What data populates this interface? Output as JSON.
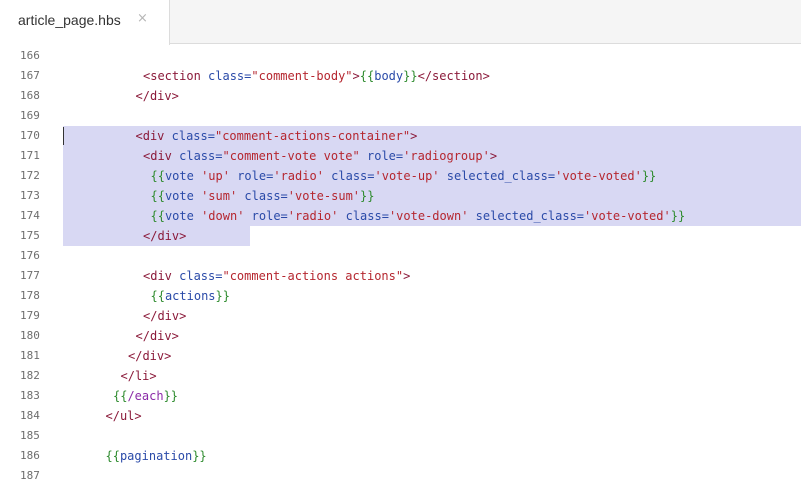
{
  "tab": {
    "title": "article_page.hbs",
    "close_glyph": "×"
  },
  "selection_color": "#d8d8f3",
  "lines": [
    {
      "n": "166",
      "indent": 0,
      "tokens": []
    },
    {
      "n": "167",
      "indent": 9,
      "tokens": [
        [
          "tag",
          "<section "
        ],
        [
          "attr",
          "class="
        ],
        [
          "strv",
          "\"comment-body\""
        ],
        [
          "tag",
          ">"
        ],
        [
          "hb",
          "{{"
        ],
        [
          "hbn",
          "body"
        ],
        [
          "hb",
          "}}"
        ],
        [
          "tag",
          "</section>"
        ]
      ]
    },
    {
      "n": "168",
      "indent": 8,
      "tokens": [
        [
          "tag",
          "</div>"
        ]
      ]
    },
    {
      "n": "169",
      "indent": 0,
      "tokens": []
    },
    {
      "n": "170",
      "indent": 8,
      "tokens": [
        [
          "tag",
          "<div "
        ],
        [
          "attr",
          "class="
        ],
        [
          "strv",
          "\"comment-actions-container\""
        ],
        [
          "tag",
          ">"
        ]
      ]
    },
    {
      "n": "171",
      "indent": 9,
      "tokens": [
        [
          "tag",
          "<div "
        ],
        [
          "attr",
          "class="
        ],
        [
          "strv",
          "\"comment-vote vote\""
        ],
        [
          "attr",
          " role="
        ],
        [
          "strv",
          "'radiogroup'"
        ],
        [
          "tag",
          ">"
        ]
      ]
    },
    {
      "n": "172",
      "indent": 10,
      "tokens": [
        [
          "hb",
          "{{"
        ],
        [
          "hbn",
          "vote "
        ],
        [
          "strv",
          "'up'"
        ],
        [
          "hbn",
          " role="
        ],
        [
          "strv",
          "'radio'"
        ],
        [
          "hbn",
          " class="
        ],
        [
          "strv",
          "'vote-up'"
        ],
        [
          "hbn",
          " selected_class="
        ],
        [
          "strv",
          "'vote-voted'"
        ],
        [
          "hb",
          "}}"
        ]
      ]
    },
    {
      "n": "173",
      "indent": 10,
      "tokens": [
        [
          "hb",
          "{{"
        ],
        [
          "hbn",
          "vote "
        ],
        [
          "strv",
          "'sum'"
        ],
        [
          "hbn",
          " class="
        ],
        [
          "strv",
          "'vote-sum'"
        ],
        [
          "hb",
          "}}"
        ]
      ]
    },
    {
      "n": "174",
      "indent": 10,
      "tokens": [
        [
          "hb",
          "{{"
        ],
        [
          "hbn",
          "vote "
        ],
        [
          "strv",
          "'down'"
        ],
        [
          "hbn",
          " role="
        ],
        [
          "strv",
          "'radio'"
        ],
        [
          "hbn",
          " class="
        ],
        [
          "strv",
          "'vote-down'"
        ],
        [
          "hbn",
          " selected_class="
        ],
        [
          "strv",
          "'vote-voted'"
        ],
        [
          "hb",
          "}}"
        ]
      ]
    },
    {
      "n": "175",
      "indent": 9,
      "tokens": [
        [
          "tag",
          "</div>"
        ]
      ]
    },
    {
      "n": "176",
      "indent": 0,
      "tokens": []
    },
    {
      "n": "177",
      "indent": 9,
      "tokens": [
        [
          "tag",
          "<div "
        ],
        [
          "attr",
          "class="
        ],
        [
          "strv",
          "\"comment-actions actions\""
        ],
        [
          "tag",
          ">"
        ]
      ]
    },
    {
      "n": "178",
      "indent": 10,
      "tokens": [
        [
          "hb",
          "{{"
        ],
        [
          "hbn",
          "actions"
        ],
        [
          "hb",
          "}}"
        ]
      ]
    },
    {
      "n": "179",
      "indent": 9,
      "tokens": [
        [
          "tag",
          "</div>"
        ]
      ]
    },
    {
      "n": "180",
      "indent": 8,
      "tokens": [
        [
          "tag",
          "</div>"
        ]
      ]
    },
    {
      "n": "181",
      "indent": 7,
      "tokens": [
        [
          "tag",
          "</div>"
        ]
      ]
    },
    {
      "n": "182",
      "indent": 6,
      "tokens": [
        [
          "tag",
          "</li>"
        ]
      ]
    },
    {
      "n": "183",
      "indent": 5,
      "tokens": [
        [
          "hb",
          "{{"
        ],
        [
          "hbkw",
          "/each"
        ],
        [
          "hb",
          "}}"
        ]
      ]
    },
    {
      "n": "184",
      "indent": 4,
      "tokens": [
        [
          "tag",
          "</ul>"
        ]
      ]
    },
    {
      "n": "185",
      "indent": 0,
      "tokens": []
    },
    {
      "n": "186",
      "indent": 4,
      "tokens": [
        [
          "hb",
          "{{"
        ],
        [
          "hbn",
          "pagination"
        ],
        [
          "hb",
          "}}"
        ]
      ]
    },
    {
      "n": "187",
      "indent": 0,
      "tokens": []
    }
  ]
}
